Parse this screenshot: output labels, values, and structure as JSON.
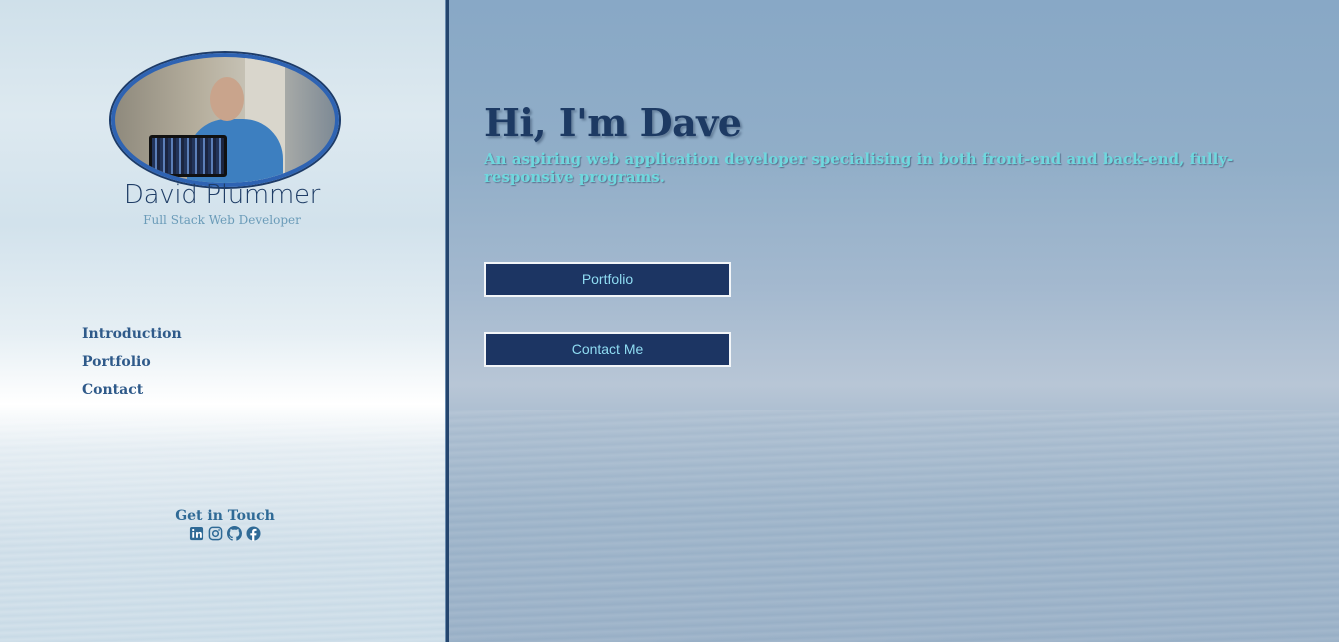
{
  "profile": {
    "name": "David Plummer",
    "role": "Full Stack Web Developer"
  },
  "nav": {
    "items": [
      {
        "label": "Introduction"
      },
      {
        "label": "Portfolio"
      },
      {
        "label": "Contact"
      }
    ]
  },
  "contact": {
    "title": "Get in Touch",
    "socials": [
      "linkedin-icon",
      "instagram-icon",
      "github-icon",
      "facebook-icon"
    ]
  },
  "hero": {
    "title": "Hi, I'm Dave",
    "subtitle": "An aspiring web application developer specialising in both front-end and back-end, fully-responsive programs."
  },
  "buttons": {
    "portfolio": "Portfolio",
    "contact": "Contact Me"
  },
  "colors": {
    "accent_dark": "#1c3563",
    "accent_teal": "#6fd8de",
    "nav_text": "#2f5a8a"
  }
}
